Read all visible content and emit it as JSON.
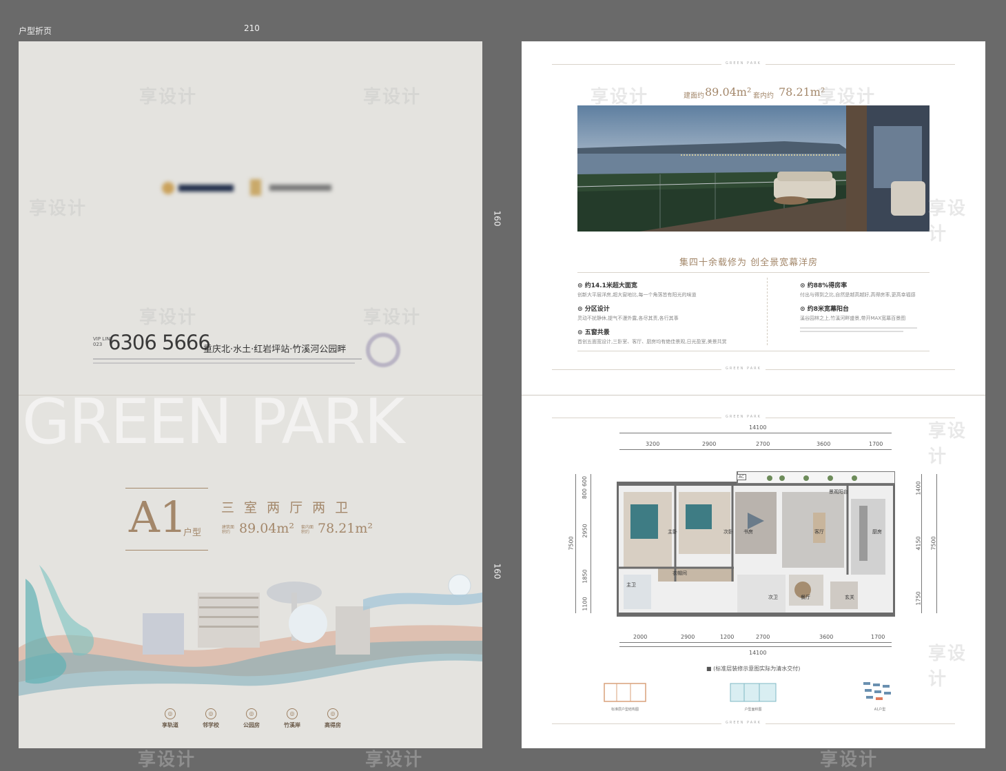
{
  "canvas": {
    "label": "户型折页",
    "width_label": "210",
    "height_label": "160"
  },
  "left_page": {
    "hotline_prefix": "VIP LINE\n023",
    "hotline": "6306 5666",
    "location": "重庆北·水土·红岩坪站·竹溪河公园畔",
    "big_text": "GREEN PARK",
    "unit_code": "A1",
    "unit_suffix": "户型",
    "layout": "三 室 两 厅 两 卫",
    "built_area_label": "建筑面积约",
    "built_area": "89.04m²",
    "inner_area_label": "套内面积约",
    "inner_area": "78.21m²",
    "features": [
      {
        "icon": "metro-icon",
        "label": "享轨道"
      },
      {
        "icon": "school-icon",
        "label": "邻学校"
      },
      {
        "icon": "park-icon",
        "label": "公园房"
      },
      {
        "icon": "river-icon",
        "label": "竹溪岸"
      },
      {
        "icon": "house-icon",
        "label": "高得房"
      }
    ]
  },
  "right_page": {
    "header_mark": "GREEN PARK",
    "area_line_built_label": "建面约",
    "area_line_built": "89.04m²",
    "area_line_inner_label": "套内约",
    "area_line_inner": "78.21m²",
    "slogan": "集四十余载修为 创全景宽幕洋房",
    "features_left": [
      {
        "title": "约14.1米超大面宽",
        "text": "创新大平层洋房,超大窗地比,每一个角落皆有阳光的味道"
      },
      {
        "title": "分区设计",
        "text": "灵动不扰静休,提气不漫外露,各尽其责,各行其事"
      },
      {
        "title": "五窗共景",
        "text": "首创五面宽设计,三卧室、客厅、厨房均有绝佳景观,日光盈室,美景共赏"
      }
    ],
    "features_right": [
      {
        "title": "约88%得房率",
        "text": "付出与得到之比,自然是越高越好,高得房率,更高幸福感"
      },
      {
        "title": "约8米宽幕阳台",
        "text": "溪谷园林之上,竹溪河畔盛景,带开MAX宽幕百景图"
      }
    ],
    "plan": {
      "top_total": "14100",
      "top_dims": [
        "3200",
        "2900",
        "2700",
        "3600",
        "1700"
      ],
      "bottom_dims": [
        "2000",
        "2900",
        "1200",
        "2700",
        "3600",
        "1700"
      ],
      "bottom_total": "14100",
      "left_dims": [
        "600",
        "800",
        "2950",
        "1850",
        "1100"
      ],
      "left_total": "7500",
      "right_dims": [
        "1400",
        "4150",
        "1750"
      ],
      "right_total": "7500",
      "rooms": [
        "景观阳台",
        "主卧",
        "次卧",
        "书房",
        "客厅",
        "厨房",
        "衣帽间",
        "主卫",
        "次卫",
        "餐厅",
        "玄关"
      ],
      "ac_label": "AC",
      "note": "■ (标准层装修示意图实际为清水交付)",
      "thumbnails": [
        "标准层户型结构图",
        "户型面积图",
        "A1户型"
      ]
    }
  },
  "colors": {
    "left_bg": "#e4e3df",
    "right_bg": "#ffffff",
    "gold": "#a3876a",
    "outer_bg": "#6a6a6a"
  }
}
